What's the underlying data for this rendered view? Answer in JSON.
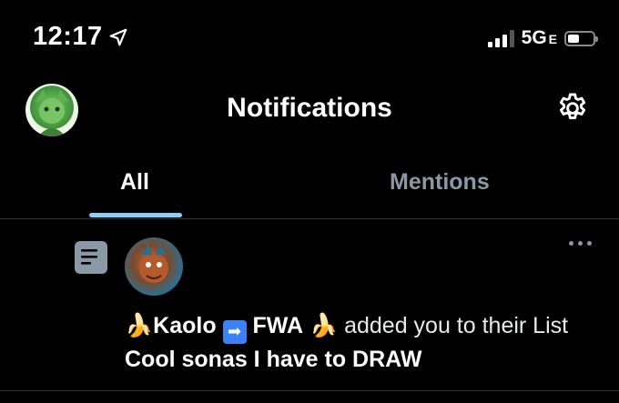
{
  "status_bar": {
    "time": "12:17",
    "network": "5G",
    "network_suffix": "E"
  },
  "header": {
    "title": "Notifications"
  },
  "tabs": [
    {
      "label": "All",
      "active": true
    },
    {
      "label": "Mentions",
      "active": false
    }
  ],
  "notification": {
    "actor_prefix_emoji": "🍌",
    "actor_name_part1": "Kaolo",
    "actor_arrow": "➡",
    "actor_name_part2": "FWA",
    "actor_suffix_emoji": "🍌",
    "action_text": " added you to their List ",
    "list_name": "Cool sonas I have to DRAW"
  },
  "colors": {
    "background": "#000000",
    "tab_underline": "#8ecdf8",
    "muted": "#8b98a5"
  }
}
